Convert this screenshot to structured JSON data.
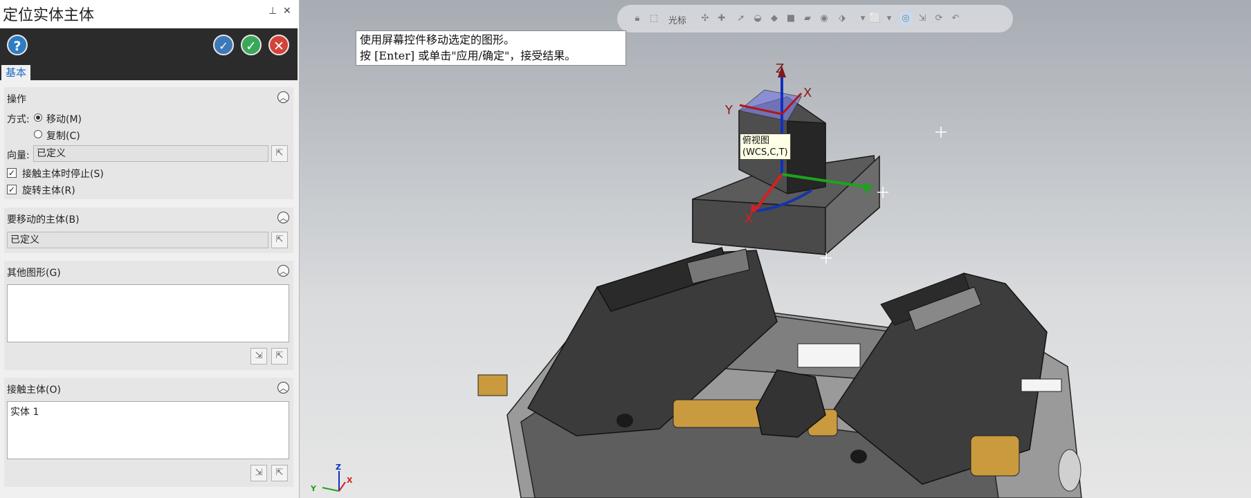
{
  "dialog": {
    "title": "定位实体主体",
    "tab": "基本",
    "toolbar": {
      "help": "?",
      "apply": "✓",
      "ok": "✓",
      "cancel": "✕"
    },
    "operation": {
      "header": "操作",
      "mode_label": "方式:",
      "move": "移动(M)",
      "copy": "复制(C)",
      "vector_label": "向量:",
      "vector_value": "已定义",
      "stop_on_contact": "接触主体时停止(S)",
      "rotate_body": "旋转主体(R)"
    },
    "body_to_move": {
      "header": "要移动的主体(B)",
      "value": "已定义"
    },
    "other_geometry": {
      "header": "其他图形(G)"
    },
    "contact_body": {
      "header": "接触主体(O)",
      "items": [
        "实体 1"
      ]
    }
  },
  "viewport": {
    "toolbar_cursor_label": "光标",
    "hint_line1": "使用屏幕控件移动选定的图形。",
    "hint_line2": "按 [Enter] 或单击\"应用/确定\"，接受结果。",
    "view_tag_line1": "俯视图",
    "view_tag_line2": "(WCS,C,T)",
    "axes": {
      "x": "X",
      "y": "Y",
      "z": "Z"
    },
    "triad": {
      "x": "X",
      "y": "Y",
      "z": "Z"
    }
  },
  "colors": {
    "x_axis": "#d42020",
    "y_axis": "#1ea21e",
    "z_axis": "#1030c0",
    "accent": "#1d6fc4"
  }
}
